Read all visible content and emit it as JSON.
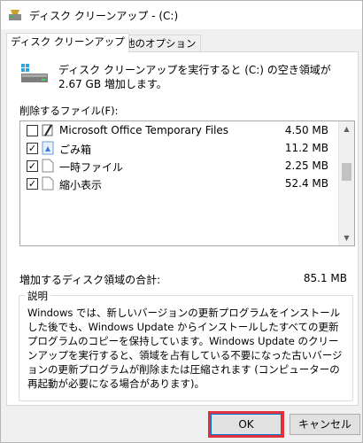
{
  "window": {
    "title": "ディスク クリーンアップ - (C:)"
  },
  "tabs": [
    {
      "label": "ディスク クリーンアップ",
      "active": true
    },
    {
      "label": "その他のオプション",
      "active": false
    }
  ],
  "intro_text": "ディスク クリーンアップを実行すると (C:) の空き領域が 2.67 GB 増加します。",
  "files_label": "削除するファイル(F):",
  "file_list": [
    {
      "name": "Microsoft Office Temporary Files",
      "size": "4.50 MB",
      "checked": false,
      "icon": "office-temp-files-icon"
    },
    {
      "name": "ごみ箱",
      "size": "11.2 MB",
      "checked": true,
      "icon": "recycle-bin-icon"
    },
    {
      "name": "一時ファイル",
      "size": "2.25 MB",
      "checked": true,
      "icon": "document-icon"
    },
    {
      "name": "縮小表示",
      "size": "52.4 MB",
      "checked": true,
      "icon": "document-icon"
    }
  ],
  "total": {
    "label": "増加するディスク領域の合計:",
    "value": "85.1 MB"
  },
  "description": {
    "legend": "説明",
    "text": "Windows では、新しいバージョンの更新プログラムをインストールした後でも、Windows Update からインストールしたすべての更新プログラムのコピーを保持しています。Windows Update のクリーンアップを実行すると、領域を占有している不要になった古いバージョンの更新プログラムが削除または圧縮されます (コンピューターの再起動が必要になる場合があります)。"
  },
  "buttons": {
    "ok": "OK",
    "cancel": "キャンセル"
  },
  "colors": {
    "highlight": "#e0323c",
    "accent": "#0078d7"
  }
}
